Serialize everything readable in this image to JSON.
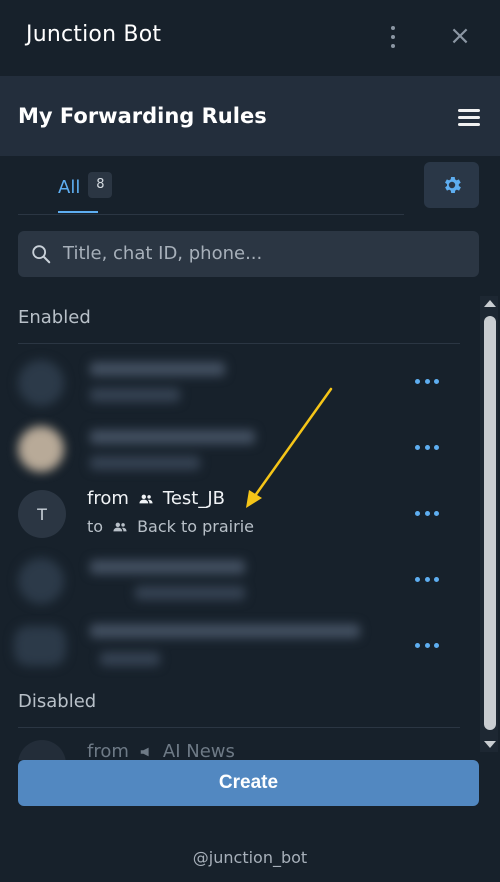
{
  "window": {
    "title": "Junction Bot"
  },
  "header": {
    "title": "My Forwarding Rules"
  },
  "tabs": [
    {
      "label": "All",
      "count": "8"
    }
  ],
  "search": {
    "placeholder": "Title, chat ID, phone..."
  },
  "sections": {
    "enabled_label": "Enabled",
    "disabled_label": "Disabled"
  },
  "enabled_rules": [
    {
      "blurred": true
    },
    {
      "blurred": true
    },
    {
      "blurred": false,
      "avatar_initial": "T",
      "from_prefix": "from",
      "from_name": "Test_JB",
      "to_prefix": "to",
      "to_name": "Back to prairie"
    },
    {
      "blurred": true
    },
    {
      "blurred": true
    }
  ],
  "disabled_rules": [
    {
      "from_prefix": "from",
      "from_name": "AI News"
    }
  ],
  "create_button": {
    "label": "Create"
  },
  "footer": {
    "text": "@junction_bot"
  },
  "colors": {
    "accent": "#5eaef1",
    "button": "#5288c1",
    "background": "#17212b",
    "header": "#232e3c",
    "annotation_arrow": "#f5c518"
  },
  "icons": [
    "kebab-menu-icon",
    "close-icon",
    "hamburger-menu-icon",
    "gear-icon",
    "search-icon",
    "more-icon",
    "group-icon",
    "arrow-annotation"
  ]
}
